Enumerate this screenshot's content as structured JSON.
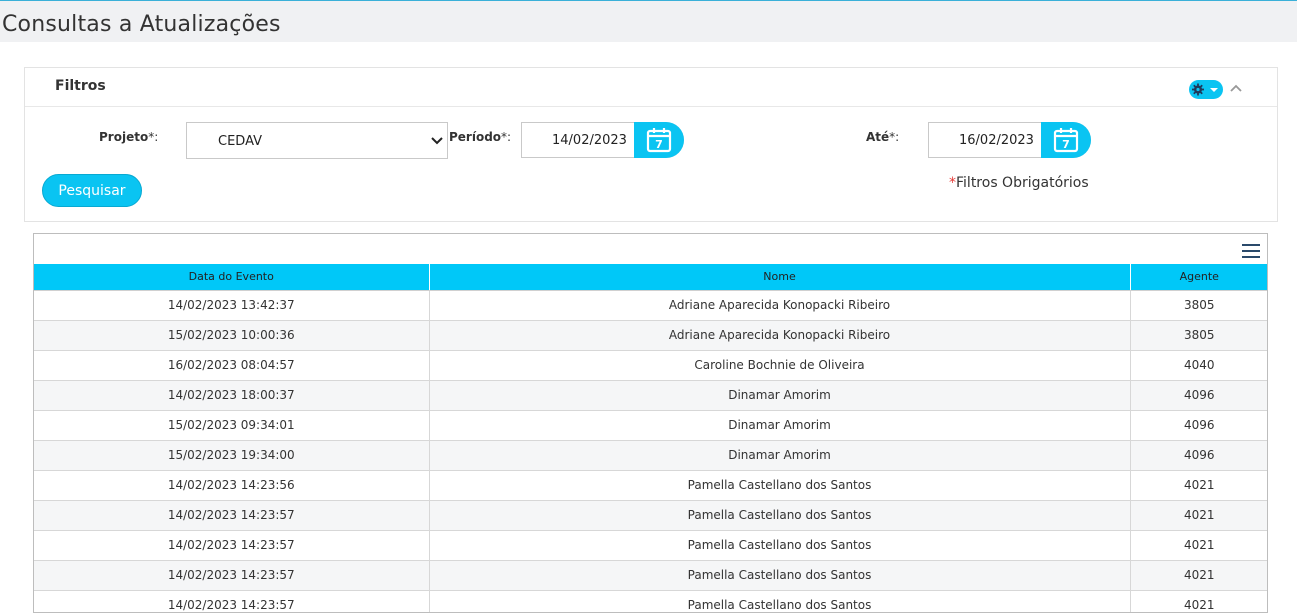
{
  "page": {
    "title": "Consultas a Atualizações"
  },
  "filters": {
    "title": "Filtros",
    "projeto_label": "Projeto",
    "periodo_label": "Período",
    "ate_label": "Até",
    "required_mark": "*:",
    "projeto_value": "CEDAV",
    "periodo_value": "14/02/2023",
    "ate_value": "16/02/2023",
    "search_label": "Pesquisar",
    "required_star": "*",
    "required_note": "Filtros Obrigatórios",
    "calendar_day": "7"
  },
  "table": {
    "columns": [
      "Data do Evento",
      "Nome",
      "Agente"
    ],
    "rows": [
      [
        "14/02/2023 13:42:37",
        "Adriane Aparecida Konopacki Ribeiro",
        "3805"
      ],
      [
        "15/02/2023 10:00:36",
        "Adriane Aparecida Konopacki Ribeiro",
        "3805"
      ],
      [
        "16/02/2023 08:04:57",
        "Caroline Bochnie de Oliveira",
        "4040"
      ],
      [
        "14/02/2023 18:00:37",
        "Dinamar Amorim",
        "4096"
      ],
      [
        "15/02/2023 09:34:01",
        "Dinamar Amorim",
        "4096"
      ],
      [
        "15/02/2023 19:34:00",
        "Dinamar Amorim",
        "4096"
      ],
      [
        "14/02/2023 14:23:56",
        "Pamella Castellano dos Santos",
        "4021"
      ],
      [
        "14/02/2023 14:23:57",
        "Pamella Castellano dos Santos",
        "4021"
      ],
      [
        "14/02/2023 14:23:57",
        "Pamella Castellano dos Santos",
        "4021"
      ],
      [
        "14/02/2023 14:23:57",
        "Pamella Castellano dos Santos",
        "4021"
      ],
      [
        "14/02/2023 14:23:57",
        "Pamella Castellano dos Santos",
        "4021"
      ]
    ]
  },
  "colors": {
    "accent": "#0ac4f2",
    "header": "#00c8f8",
    "required": "#e53935"
  },
  "icons": [
    "gear-icon",
    "chevron-down-icon",
    "chevron-up-icon",
    "calendar-icon",
    "menu-icon"
  ]
}
